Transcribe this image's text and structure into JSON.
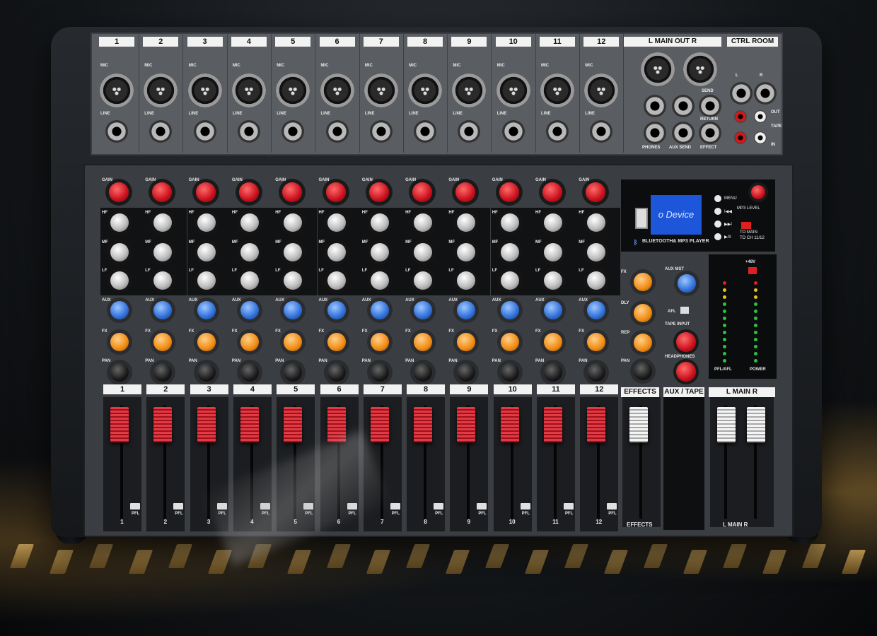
{
  "input_channels": [
    "1",
    "2",
    "3",
    "4",
    "5",
    "6",
    "7",
    "8",
    "9",
    "10",
    "11",
    "12"
  ],
  "jack_labels": {
    "mic": "MIC",
    "line": "LINE"
  },
  "rear_sections": {
    "main_out": "L  MAIN OUT  R",
    "ctrl_room": "CTRL ROOM",
    "jack_l": "L",
    "jack_r": "R",
    "phones": "PHONES",
    "aux_send": "AUX SEND",
    "send": "SEND",
    "return": "RETURN",
    "effect": "EFFECT",
    "out": "OUT",
    "tape": "TAPE",
    "in": "IN"
  },
  "strip_labels": {
    "gain": "GAIN",
    "hf": "HF",
    "mf": "MF",
    "lf": "LF",
    "aux": "AUX",
    "fx": "FX",
    "pan": "PAN",
    "pfl": "PFL"
  },
  "player": {
    "screen_text": "o Device",
    "title": "BLUETOOTH& MP3 PLAYER",
    "buttons": [
      "MENU",
      "I◀◀",
      "▶▶I",
      "▶/II"
    ],
    "mp3_level": "MP3 LEVEL",
    "to_main": "TO MAIN",
    "to_ch": "TO CH 11/12"
  },
  "effects_section": {
    "knobs": [
      "FX",
      "DLY",
      "REP",
      "PAN"
    ],
    "label": "EFFECTS",
    "bottom_label": "EFFECTS"
  },
  "aux_tape": {
    "aux_mst": "AUX MST",
    "afl": "AFL",
    "tape_input": "TAPE INPUT",
    "headphones": "HEADPHONES",
    "label": "AUX / TAPE"
  },
  "meter": {
    "phantom": "+48V",
    "pfl_afl": "PFL/AFL",
    "power": "POWER"
  },
  "main_fader": {
    "label": "L  MAIN  R",
    "bottom_label": "L  MAIN  R"
  },
  "colors": {
    "gain_knob": "#c8101c",
    "aux_knob": "#2f6fd8",
    "fx_knob": "#f08a12",
    "fader_cap": "#d92a35",
    "lcd": "#1d56d8"
  }
}
